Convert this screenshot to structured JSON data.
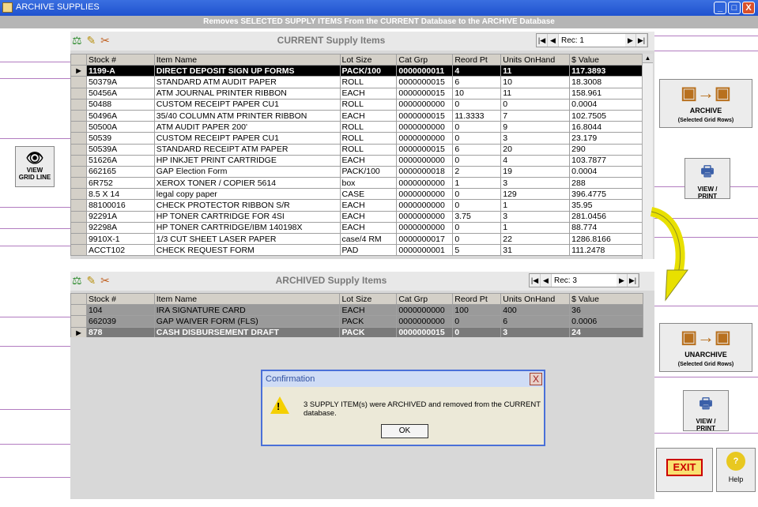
{
  "window": {
    "title": "ARCHIVE SUPPLIES",
    "minimize": "_",
    "maximize": "□",
    "close": "X"
  },
  "banner": "Removes SELECTED SUPPLY ITEMS From the CURRENT Database to the ARCHIVE Database",
  "toolbar_icons": [
    "scale-icon",
    "pencil-icon",
    "tools-icon"
  ],
  "current": {
    "caption": "CURRENT Supply Items",
    "record": "Rec: 1",
    "columns": [
      "Stock #",
      "Item Name",
      "Lot Size",
      "Cat Grp",
      "Reord Pt",
      "Units OnHand",
      "$ Value"
    ],
    "rows": [
      [
        "1199-A",
        "DIRECT DEPOSIT SIGN UP FORMS",
        "PACK/100",
        "0000000011",
        "4",
        "11",
        "117.3893"
      ],
      [
        "50379A",
        "STANDARD ATM AUDIT PAPER",
        "ROLL",
        "0000000015",
        "6",
        "10",
        "18.3008"
      ],
      [
        "50456A",
        "ATM JOURNAL PRINTER RIBBON",
        "EACH",
        "0000000015",
        "10",
        "11",
        "158.961"
      ],
      [
        "50488",
        "CUSTOM RECEIPT PAPER CU1",
        "ROLL",
        "0000000000",
        "0",
        "0",
        "0.0004"
      ],
      [
        "50496A",
        "35/40 COLUMN ATM PRINTER RIBBON",
        "EACH",
        "0000000015",
        "11.3333",
        "7",
        "102.7505"
      ],
      [
        "50500A",
        "ATM AUDIT PAPER 200'",
        "ROLL",
        "0000000000",
        "0",
        "9",
        "16.8044"
      ],
      [
        "50539",
        "CUSTOM RECEIPT PAPER CU1",
        "ROLL",
        "0000000000",
        "0",
        "3",
        "23.179"
      ],
      [
        "50539A",
        "STANDARD RECEIPT ATM PAPER",
        "ROLL",
        "0000000015",
        "6",
        "20",
        "290"
      ],
      [
        "51626A",
        "HP INKJET PRINT CARTRIDGE",
        "EACH",
        "0000000000",
        "0",
        "4",
        "103.7877"
      ],
      [
        "662165",
        "GAP Election Form",
        "PACK/100",
        "0000000018",
        "2",
        "19",
        "0.0004"
      ],
      [
        "6R752",
        "XEROX TONER / COPIER 5614",
        "box",
        "0000000000",
        "1",
        "3",
        "288"
      ],
      [
        "8.5 X 14",
        "legal copy paper",
        "CASE",
        "0000000000",
        "0",
        "129",
        "396.4775"
      ],
      [
        "88100016",
        "CHECK PROTECTOR RIBBON  S/R",
        "EACH",
        "0000000000",
        "0",
        "1",
        "35.95"
      ],
      [
        "92291A",
        "HP TONER CARTRIDGE FOR 4SI",
        "EACH",
        "0000000000",
        "3.75",
        "3",
        "281.0456"
      ],
      [
        "92298A",
        "HP TONER CARTRIDGE/IBM 140198X",
        "EACH",
        "0000000000",
        "0",
        "1",
        "88.774"
      ],
      [
        "9910X-1",
        "1/3 CUT SHEET LASER PAPER",
        "case/4 RM",
        "0000000017",
        "0",
        "22",
        "1286.8166"
      ],
      [
        "ACCT102",
        "CHECK REQUEST FORM",
        "PAD",
        "0000000001",
        "5",
        "31",
        "111.2478"
      ]
    ]
  },
  "archived": {
    "caption": "ARCHIVED Supply Items",
    "record": "Rec: 3",
    "columns": [
      "Stock #",
      "Item Name",
      "Lot Size",
      "Cat Grp",
      "Reord Pt",
      "Units OnHand",
      "$ Value"
    ],
    "rows": [
      [
        "104",
        "IRA SIGNATURE CARD",
        "EACH",
        "0000000000",
        "100",
        "400",
        "36"
      ],
      [
        "662039",
        "GAP WAIVER FORM (FLS)",
        "PACK",
        "0000000000",
        "0",
        "6",
        "0.0006"
      ],
      [
        "878",
        "CASH DISBURSEMENT DRAFT",
        "PACK",
        "0000000015",
        "0",
        "3",
        "24"
      ]
    ]
  },
  "buttons": {
    "view_grid_line": [
      "VIEW",
      "GRID LINE"
    ],
    "archive": [
      "ARCHIVE",
      "(Selected Grid Rows)"
    ],
    "view_print": [
      "VIEW /",
      "PRINT"
    ],
    "unarchive": [
      "UNARCHIVE",
      "(Selected Grid Rows)"
    ],
    "exit": "EXIT",
    "help": "Help",
    "help_icon": "?"
  },
  "dialog": {
    "title": "Confirmation",
    "close": "X",
    "message": "3 SUPPLY ITEM(s) were ARCHIVED and removed from the CURRENT database.",
    "warn_glyph": "!",
    "ok": "OK"
  }
}
